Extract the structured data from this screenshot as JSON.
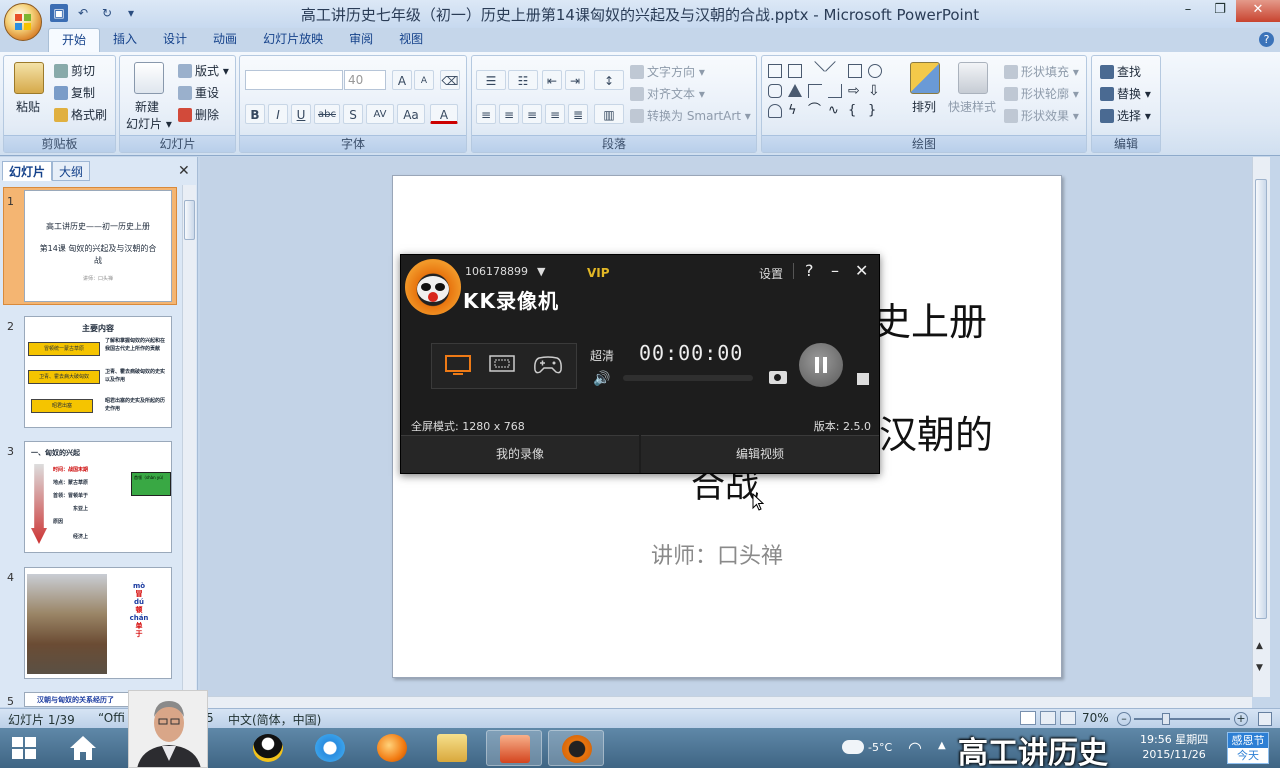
{
  "window": {
    "title": "高工讲历史七年级（初一）历史上册第14课匈奴的兴起及与汉朝的合战.pptx - Microsoft PowerPoint",
    "minimize": "–",
    "maximize": "❐",
    "close": "✕"
  },
  "ribbon": {
    "tabs": [
      "开始",
      "插入",
      "设计",
      "动画",
      "幻灯片放映",
      "审阅",
      "视图"
    ],
    "help": "?",
    "clipboard": {
      "label": "剪贴板",
      "paste": "粘贴",
      "cut": "剪切",
      "copy": "复制",
      "format_painter": "格式刷"
    },
    "slides": {
      "label": "幻灯片",
      "new_slide_1": "新建",
      "new_slide_2": "幻灯片",
      "layout": "版式",
      "reset": "重设",
      "delete": "删除"
    },
    "font": {
      "label": "字体",
      "size": "40",
      "bold": "B",
      "italic": "I",
      "underline": "U",
      "strike": "abc",
      "shadow": "S",
      "spacing": "AV",
      "case": "Aa",
      "color": "A",
      "grow": "A",
      "shrink": "A"
    },
    "paragraph": {
      "label": "段落",
      "text_direction": "文字方向",
      "align_text": "对齐文本",
      "smartart": "转换为 SmartArt"
    },
    "drawing": {
      "label": "绘图",
      "arrange": "排列",
      "quick_styles": "快速样式",
      "shape_fill": "形状填充",
      "shape_outline": "形状轮廓",
      "shape_effects": "形状效果"
    },
    "editing": {
      "label": "编辑",
      "find": "查找",
      "replace": "替换",
      "select": "选择"
    }
  },
  "left_panel": {
    "tabs": [
      "幻灯片",
      "大纲"
    ],
    "close": "✕",
    "thumbnails": [
      {
        "num": "1",
        "line1": "高工讲历史——初一历史上册",
        "line2": "第14课 匈奴的兴起及与汉朝的合战",
        "line3": "讲师：口头禅"
      },
      {
        "num": "2",
        "title": "主要内容",
        "items": [
          "冒顿统一蒙古草原",
          "卫青、霍去病大破匈奴",
          "昭君出塞"
        ],
        "notes": [
          "了解和掌握匈奴的兴起和在我国古代史上所作的贡献",
          "卫青、霍去病破匈奴的史实以及作用",
          "昭君出塞的史实及所起的历史作用"
        ]
      },
      {
        "num": "3",
        "title": "一、匈奴的兴起",
        "lines": [
          "时间：战国末期",
          "地点：蒙古草原",
          "首领：冒顿单于",
          "东亚上",
          "经济上",
          "原因"
        ],
        "box": "首领（shàn yú）"
      },
      {
        "num": "4",
        "pinyin": [
          "mò",
          "冒",
          "dú",
          "顿",
          "chán",
          "单",
          "于"
        ]
      },
      {
        "num": "5",
        "title": "汉朝与匈奴的关系经历了"
      }
    ]
  },
  "slide": {
    "title_fragment_1": "史上册",
    "title_fragment_2": "汉朝的",
    "title_fragment_3": "合战",
    "lecturer": "讲师：口头禅"
  },
  "status_bar": {
    "slide_counter": "幻灯片 1/39",
    "theme": "“Offi",
    "theme_tail": "5",
    "language": "中文(简体，中国)",
    "zoom": "70%"
  },
  "kk_recorder": {
    "user_id": "106178899",
    "vip": "VIP",
    "brand": "KK录像机",
    "settings": "设置",
    "help": "?",
    "minimize": "–",
    "close": "✕",
    "quality": "超清",
    "timer": "00:00:00",
    "fullscreen_mode": "全屏模式: 1280 x 768",
    "version": "版本: 2.5.0",
    "my_recordings": "我的录像",
    "edit_video": "编辑视频"
  },
  "taskbar": {
    "temperature": "-5°C",
    "time": "19:56 星期四",
    "date": "2015/11/26",
    "badge_line1": "感恩节",
    "badge_line2": "今天",
    "overlay_title": "高工讲历史"
  }
}
